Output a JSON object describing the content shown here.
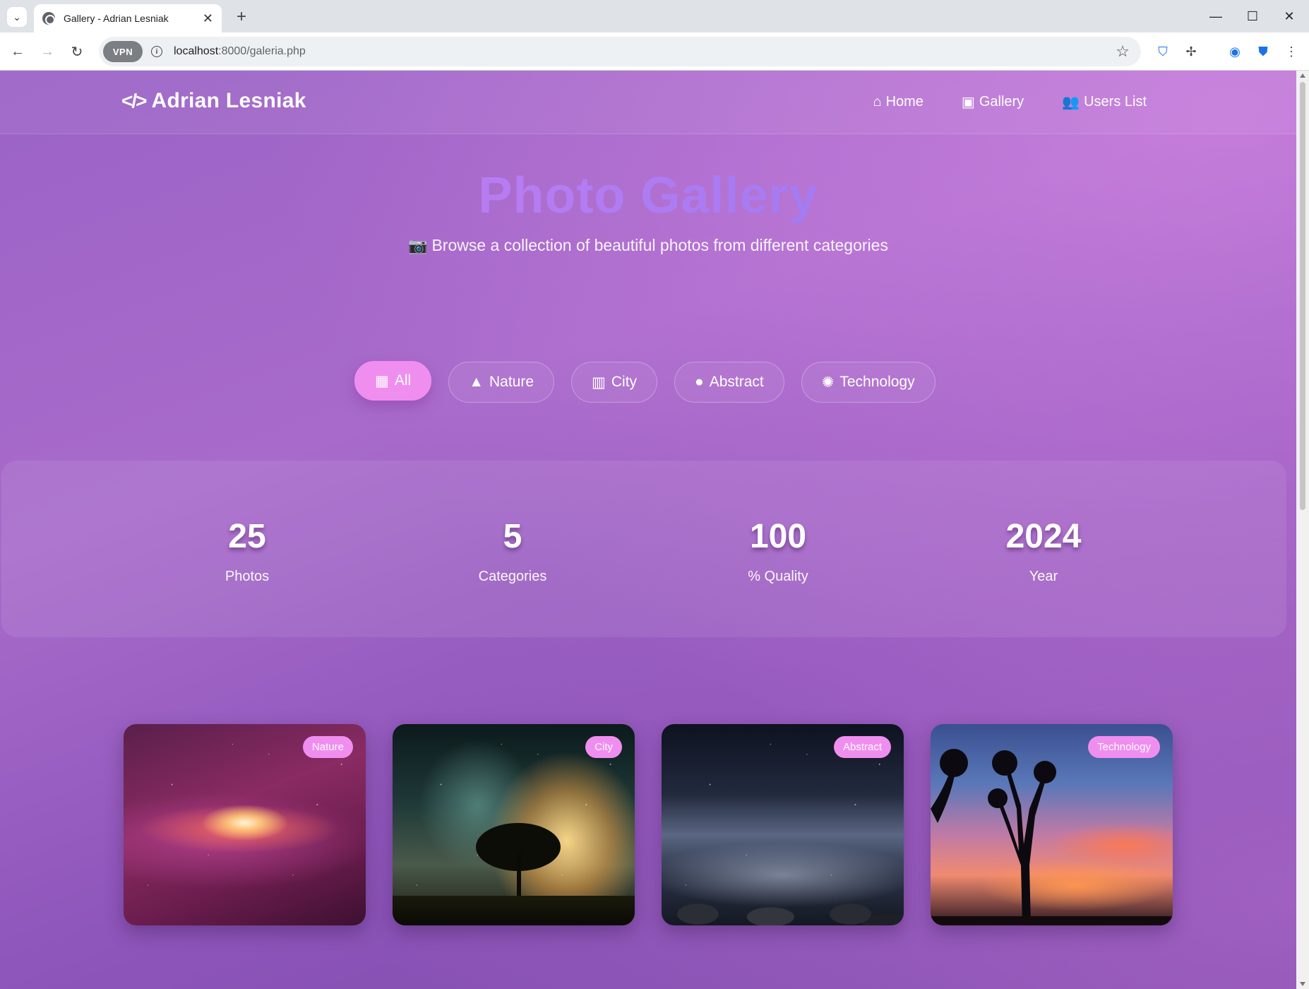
{
  "browser": {
    "tab_title": "Gallery - Adrian Lesniak",
    "url_host": "localhost",
    "url_path": ":8000/galeria.php",
    "vpn_label": "VPN"
  },
  "site": {
    "logo_text": "Adrian Lesniak",
    "nav": [
      {
        "label": "Home",
        "icon": "home-icon"
      },
      {
        "label": "Gallery",
        "icon": "images-icon"
      },
      {
        "label": "Users List",
        "icon": "users-icon"
      }
    ]
  },
  "hero": {
    "title": "Photo Gallery",
    "subtitle": "Browse a collection of beautiful photos from different categories"
  },
  "filters": [
    {
      "label": "All",
      "icon": "grid-icon",
      "active": true
    },
    {
      "label": "Nature",
      "icon": "tree-icon",
      "active": false
    },
    {
      "label": "City",
      "icon": "building-icon",
      "active": false
    },
    {
      "label": "Abstract",
      "icon": "palette-icon",
      "active": false
    },
    {
      "label": "Technology",
      "icon": "chip-icon",
      "active": false
    }
  ],
  "stats": [
    {
      "value": "25",
      "label": "Photos"
    },
    {
      "value": "5",
      "label": "Categories"
    },
    {
      "value": "100",
      "label": "% Quality"
    },
    {
      "value": "2024",
      "label": "Year"
    }
  ],
  "photos": [
    {
      "category": "Nature"
    },
    {
      "category": "City"
    },
    {
      "category": "Abstract"
    },
    {
      "category": "Technology"
    }
  ],
  "colors": {
    "accent_pink": "#f08ef0",
    "bg_purple": "#9b62c6"
  }
}
